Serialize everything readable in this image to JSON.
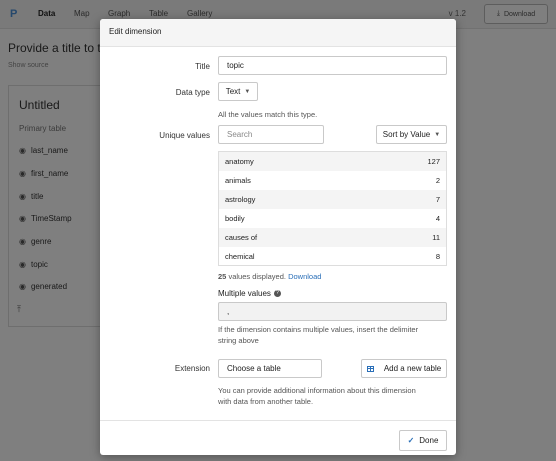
{
  "app": {
    "logo": "P",
    "nav": [
      "Data",
      "Map",
      "Graph",
      "Table",
      "Gallery"
    ],
    "version": "v 1.2",
    "download_label": "Download",
    "download_icon": "download-icon",
    "provide_title": "Provide a title to t",
    "show_source": "Show source",
    "panel_title": "Untitled",
    "panel_subtitle": "Primary table",
    "fields": [
      "last_name",
      "first_name",
      "title",
      "TimeStamp",
      "genre",
      "topic",
      "generated"
    ]
  },
  "modal": {
    "title": "Edit dimension",
    "title_label": "Title",
    "title_value": "topic",
    "datatype_label": "Data type",
    "datatype_value": "Text",
    "datatype_help": "All the values match this type.",
    "unique_label": "Unique values",
    "search_placeholder": "Search",
    "sort_label": "Sort by Value",
    "values": [
      {
        "name": "anatomy",
        "count": "127"
      },
      {
        "name": "animals",
        "count": "2"
      },
      {
        "name": "astrology",
        "count": "7"
      },
      {
        "name": "bodily",
        "count": "4"
      },
      {
        "name": "causes of",
        "count": "11"
      },
      {
        "name": "chemical",
        "count": "8"
      }
    ],
    "displayed_count": "25",
    "displayed_text": "values displayed.",
    "download_link": "Download",
    "multiple_label": "Multiple values",
    "multiple_value": ",",
    "multiple_help": [
      "If the dimension contains multiple values, insert the delimiter",
      "string above"
    ],
    "extension_label": "Extension",
    "choose_table": "Choose a table",
    "add_table": "Add a new table",
    "extension_help": [
      "You can provide additional information about this dimension",
      "with data from another table."
    ],
    "done_label": "Done",
    "accent_color": "#2a6fb8"
  }
}
